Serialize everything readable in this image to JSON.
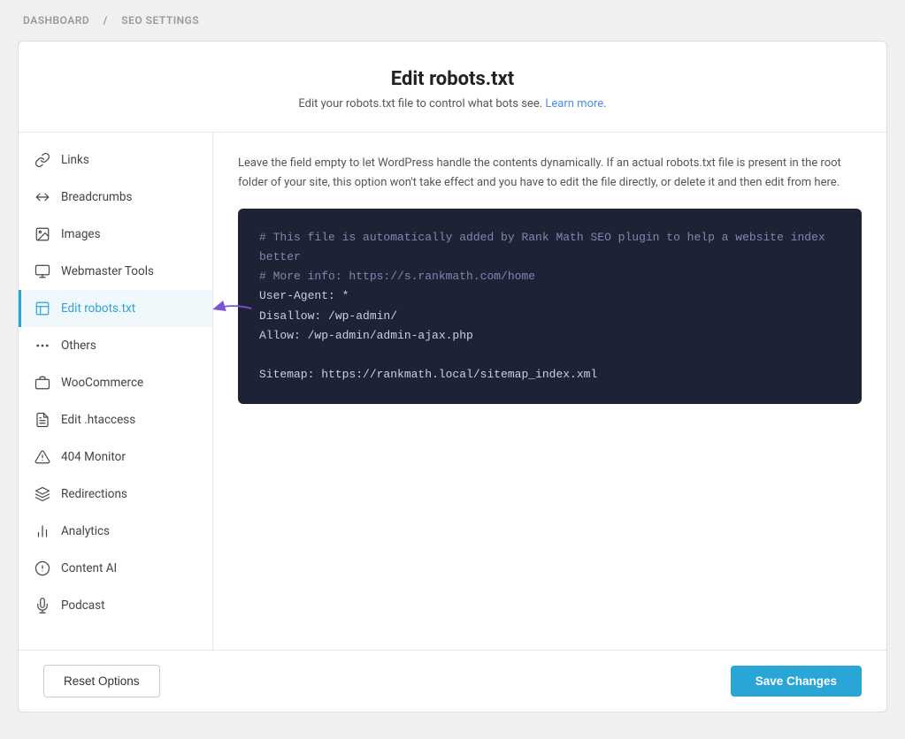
{
  "breadcrumb": {
    "dashboard": "DASHBOARD",
    "separator": "/",
    "current": "SEO SETTINGS"
  },
  "header": {
    "title": "Edit robots.txt",
    "description": "Edit your robots.txt file to control what bots see.",
    "learn_more": "Learn more"
  },
  "description": "Leave the field empty to let WordPress handle the contents dynamically. If an actual robots.txt file is present in the root folder of your site, this option won't take effect and you have to edit the file directly, or delete it and then edit from here.",
  "code_editor": {
    "lines": [
      {
        "type": "comment",
        "text": "# This file is automatically added by Rank Math SEO plugin to help a website index better"
      },
      {
        "type": "comment",
        "text": "# More info: https://s.rankmath.com/home"
      },
      {
        "type": "key",
        "text": "User-Agent: *"
      },
      {
        "type": "key",
        "text": "Disallow: /wp-admin/"
      },
      {
        "type": "key",
        "text": "Allow: /wp-admin/admin-ajax.php"
      },
      {
        "type": "empty",
        "text": ""
      },
      {
        "type": "key",
        "text": "Sitemap: https://rankmath.local/sitemap_index.xml"
      }
    ]
  },
  "sidebar": {
    "items": [
      {
        "id": "links",
        "label": "Links",
        "icon": "links"
      },
      {
        "id": "breadcrumbs",
        "label": "Breadcrumbs",
        "icon": "breadcrumbs"
      },
      {
        "id": "images",
        "label": "Images",
        "icon": "images"
      },
      {
        "id": "webmaster-tools",
        "label": "Webmaster Tools",
        "icon": "webmaster"
      },
      {
        "id": "edit-robots",
        "label": "Edit robots.txt",
        "icon": "edit-robots",
        "active": true
      },
      {
        "id": "others",
        "label": "Others",
        "icon": "others"
      },
      {
        "id": "woocommerce",
        "label": "WooCommerce",
        "icon": "woocommerce"
      },
      {
        "id": "edit-htaccess",
        "label": "Edit .htaccess",
        "icon": "htaccess"
      },
      {
        "id": "404-monitor",
        "label": "404 Monitor",
        "icon": "monitor"
      },
      {
        "id": "redirections",
        "label": "Redirections",
        "icon": "redirections"
      },
      {
        "id": "analytics",
        "label": "Analytics",
        "icon": "analytics"
      },
      {
        "id": "content-ai",
        "label": "Content AI",
        "icon": "content-ai"
      },
      {
        "id": "podcast",
        "label": "Podcast",
        "icon": "podcast"
      }
    ]
  },
  "footer": {
    "reset_label": "Reset Options",
    "save_label": "Save Changes"
  }
}
